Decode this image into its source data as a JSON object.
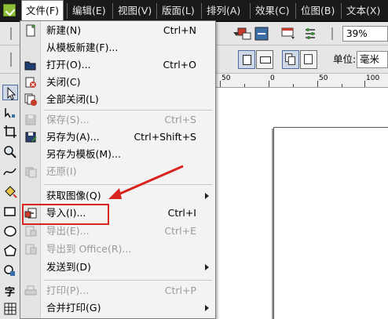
{
  "menubar": {
    "items": [
      "文件(F)",
      "编辑(E)",
      "视图(V)",
      "版面(L)",
      "排列(A)",
      "效果(C)",
      "位图(B)",
      "文本(X)"
    ]
  },
  "toolbar": {
    "zoom_value": "39%",
    "units_label": "单位:",
    "units_value": "毫米"
  },
  "ruler": {
    "h_labels": [
      "50",
      "0",
      "50",
      "100",
      "150"
    ]
  },
  "toolbox": {
    "text_tool_label": "字"
  },
  "file_menu": {
    "items": [
      {
        "label": "新建(N)",
        "shortcut": "Ctrl+N"
      },
      {
        "label": "从模板新建(F)...",
        "shortcut": ""
      },
      {
        "label": "打开(O)...",
        "shortcut": "Ctrl+O"
      },
      {
        "label": "关闭(C)",
        "shortcut": ""
      },
      {
        "label": "全部关闭(L)",
        "shortcut": ""
      },
      {
        "label": "保存(S)...",
        "shortcut": "Ctrl+S"
      },
      {
        "label": "另存为(A)...",
        "shortcut": "Ctrl+Shift+S"
      },
      {
        "label": "另存为模板(M)...",
        "shortcut": ""
      },
      {
        "label": "还原(I)",
        "shortcut": ""
      },
      {
        "label": "获取图像(Q)",
        "shortcut": ""
      },
      {
        "label": "导入(I)...",
        "shortcut": "Ctrl+I"
      },
      {
        "label": "导出(E)...",
        "shortcut": "Ctrl+E"
      },
      {
        "label": "导出到 Office(R)...",
        "shortcut": ""
      },
      {
        "label": "发送到(D)",
        "shortcut": ""
      },
      {
        "label": "打印(P)...",
        "shortcut": "Ctrl+P"
      },
      {
        "label": "合并打印(G)",
        "shortcut": ""
      }
    ]
  },
  "colors": {
    "menubar_bg": "#1a1a1a",
    "annotation_red": "#d9231f"
  }
}
